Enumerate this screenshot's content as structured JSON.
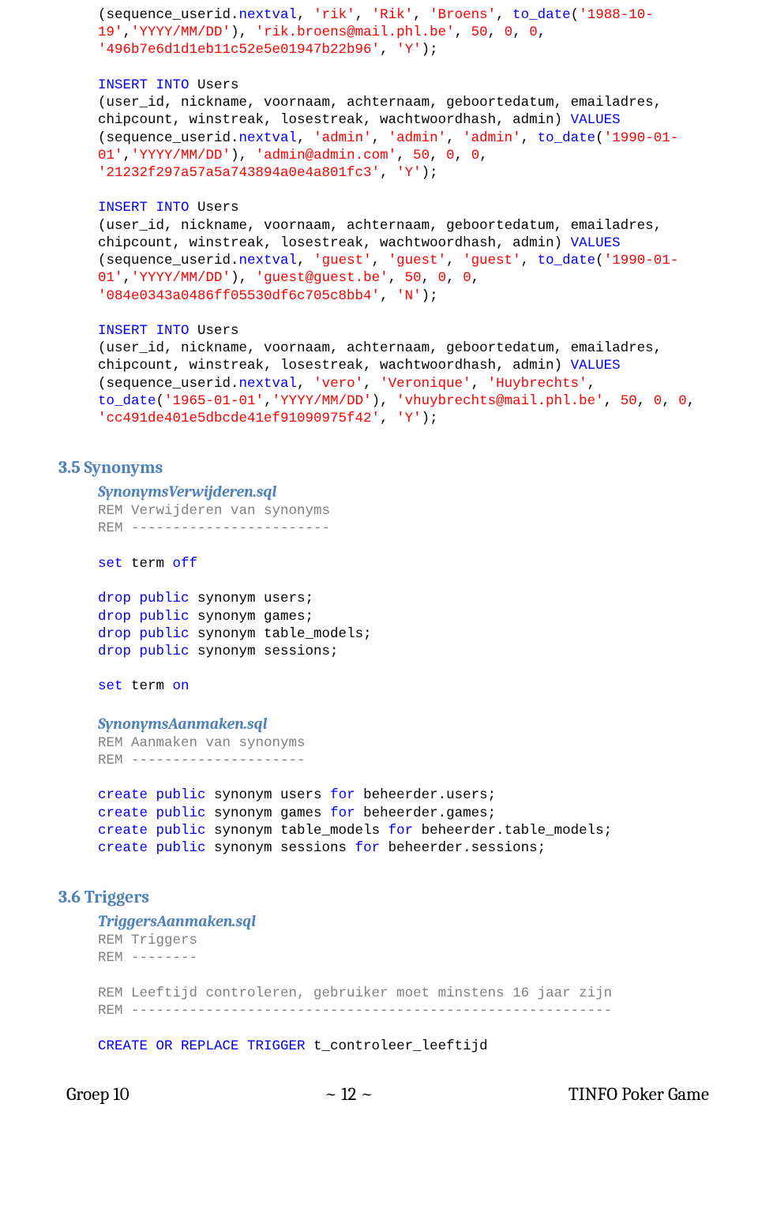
{
  "code_block_1": [
    [
      {
        "t": "(sequence_userid.",
        "c": ""
      },
      {
        "t": "nextval",
        "c": "blue"
      },
      {
        "t": ",",
        "c": ""
      },
      {
        "t": " 'rik'",
        "c": "red"
      },
      {
        "t": ",",
        "c": ""
      },
      {
        "t": " 'Rik'",
        "c": "red"
      },
      {
        "t": ",",
        "c": ""
      },
      {
        "t": " 'Broens'",
        "c": "red"
      },
      {
        "t": ",",
        "c": ""
      },
      {
        "t": " to_date",
        "c": "blue"
      },
      {
        "t": "(",
        "c": ""
      },
      {
        "t": "'1988-10-19'",
        "c": "red"
      },
      {
        "t": ",",
        "c": ""
      },
      {
        "t": "'YYYY/MM/DD'",
        "c": "red"
      },
      {
        "t": "),",
        "c": ""
      },
      {
        "t": " 'rik.broens@mail.phl.be'",
        "c": "red"
      },
      {
        "t": ",",
        "c": ""
      },
      {
        "t": " 50",
        "c": "red"
      },
      {
        "t": ",",
        "c": ""
      },
      {
        "t": " 0",
        "c": "red"
      },
      {
        "t": ",",
        "c": ""
      },
      {
        "t": " 0",
        "c": "red"
      },
      {
        "t": ",",
        "c": ""
      },
      {
        "t": " '496b7e6d1d1eb11c52e5e01947b22b96'",
        "c": "red"
      },
      {
        "t": ",",
        "c": ""
      },
      {
        "t": " 'Y'",
        "c": "red"
      },
      {
        "t": ");",
        "c": ""
      }
    ],
    [],
    [
      {
        "t": "INSERT INTO",
        "c": "blue"
      },
      {
        "t": " Users",
        "c": ""
      }
    ],
    [
      {
        "t": "(user_id, nickname, voornaam, achternaam, geboortedatum, emailadres, chipcount, winstreak, losestreak, wachtwoordhash, admin)",
        "c": ""
      },
      {
        "t": " VALUES",
        "c": "blue"
      }
    ],
    [
      {
        "t": "(sequence_userid.",
        "c": ""
      },
      {
        "t": "nextval",
        "c": "blue"
      },
      {
        "t": ",",
        "c": ""
      },
      {
        "t": " 'admin'",
        "c": "red"
      },
      {
        "t": ",",
        "c": ""
      },
      {
        "t": " 'admin'",
        "c": "red"
      },
      {
        "t": ",",
        "c": ""
      },
      {
        "t": " 'admin'",
        "c": "red"
      },
      {
        "t": ",",
        "c": ""
      },
      {
        "t": " to_date",
        "c": "blue"
      },
      {
        "t": "(",
        "c": ""
      },
      {
        "t": "'1990-01-01'",
        "c": "red"
      },
      {
        "t": ",",
        "c": ""
      },
      {
        "t": "'YYYY/MM/DD'",
        "c": "red"
      },
      {
        "t": "),",
        "c": ""
      },
      {
        "t": " 'admin@admin.com'",
        "c": "red"
      },
      {
        "t": ",",
        "c": ""
      },
      {
        "t": " 50",
        "c": "red"
      },
      {
        "t": ",",
        "c": ""
      },
      {
        "t": " 0",
        "c": "red"
      },
      {
        "t": ",",
        "c": ""
      },
      {
        "t": " 0",
        "c": "red"
      },
      {
        "t": ",",
        "c": ""
      },
      {
        "t": " '21232f297a57a5a743894a0e4a801fc3'",
        "c": "red"
      },
      {
        "t": ",",
        "c": ""
      },
      {
        "t": " 'Y'",
        "c": "red"
      },
      {
        "t": ");",
        "c": ""
      }
    ],
    [],
    [
      {
        "t": "INSERT INTO",
        "c": "blue"
      },
      {
        "t": " Users",
        "c": ""
      }
    ],
    [
      {
        "t": "(user_id, nickname, voornaam, achternaam, geboortedatum, emailadres, chipcount, winstreak, losestreak, wachtwoordhash, admin)",
        "c": ""
      },
      {
        "t": " VALUES",
        "c": "blue"
      }
    ],
    [
      {
        "t": "(sequence_userid.",
        "c": ""
      },
      {
        "t": "nextval",
        "c": "blue"
      },
      {
        "t": ",",
        "c": ""
      },
      {
        "t": " 'guest'",
        "c": "red"
      },
      {
        "t": ",",
        "c": ""
      },
      {
        "t": " 'guest'",
        "c": "red"
      },
      {
        "t": ",",
        "c": ""
      },
      {
        "t": " 'guest'",
        "c": "red"
      },
      {
        "t": ",",
        "c": ""
      },
      {
        "t": " to_date",
        "c": "blue"
      },
      {
        "t": "(",
        "c": ""
      },
      {
        "t": "'1990-01-01'",
        "c": "red"
      },
      {
        "t": ",",
        "c": ""
      },
      {
        "t": "'YYYY/MM/DD'",
        "c": "red"
      },
      {
        "t": "),",
        "c": ""
      },
      {
        "t": " 'guest@guest.be'",
        "c": "red"
      },
      {
        "t": ",",
        "c": ""
      },
      {
        "t": " 50",
        "c": "red"
      },
      {
        "t": ",",
        "c": ""
      },
      {
        "t": " 0",
        "c": "red"
      },
      {
        "t": ",",
        "c": ""
      },
      {
        "t": " 0",
        "c": "red"
      },
      {
        "t": ",",
        "c": ""
      },
      {
        "t": " '084e0343a0486ff05530df6c705c8bb4'",
        "c": "red"
      },
      {
        "t": ",",
        "c": ""
      },
      {
        "t": " 'N'",
        "c": "red"
      },
      {
        "t": ");",
        "c": ""
      }
    ],
    [],
    [
      {
        "t": "INSERT INTO",
        "c": "blue"
      },
      {
        "t": " Users",
        "c": ""
      }
    ],
    [
      {
        "t": "(user_id, nickname, voornaam, achternaam, geboortedatum, emailadres, chipcount, winstreak, losestreak, wachtwoordhash, admin)",
        "c": ""
      },
      {
        "t": " VALUES",
        "c": "blue"
      }
    ],
    [
      {
        "t": "(sequence_userid.",
        "c": ""
      },
      {
        "t": "nextval",
        "c": "blue"
      },
      {
        "t": ",",
        "c": ""
      },
      {
        "t": " 'vero'",
        "c": "red"
      },
      {
        "t": ",",
        "c": ""
      },
      {
        "t": " 'Veronique'",
        "c": "red"
      },
      {
        "t": ",",
        "c": ""
      },
      {
        "t": " 'Huybrechts'",
        "c": "red"
      },
      {
        "t": ",",
        "c": ""
      },
      {
        "t": " to_date",
        "c": "blue"
      },
      {
        "t": "(",
        "c": ""
      },
      {
        "t": "'1965-01-01'",
        "c": "red"
      },
      {
        "t": ",",
        "c": ""
      },
      {
        "t": "'YYYY/MM/DD'",
        "c": "red"
      },
      {
        "t": "),",
        "c": ""
      },
      {
        "t": " 'vhuybrechts@mail.phl.be'",
        "c": "red"
      },
      {
        "t": ",",
        "c": ""
      },
      {
        "t": " 50",
        "c": "red"
      },
      {
        "t": ",",
        "c": ""
      },
      {
        "t": " 0",
        "c": "red"
      },
      {
        "t": ",",
        "c": ""
      },
      {
        "t": " 0",
        "c": "red"
      },
      {
        "t": ",",
        "c": ""
      },
      {
        "t": " 'cc491de401e5dbcde41ef91090975f42'",
        "c": "red"
      },
      {
        "t": ",",
        "c": ""
      },
      {
        "t": " 'Y'",
        "c": "red"
      },
      {
        "t": ");",
        "c": ""
      }
    ]
  ],
  "heading_35": "3.5 Synonyms",
  "file_synverw": "SynonymsVerwijderen.sql",
  "code_block_2": [
    [
      {
        "t": "REM Verwijderen van synonyms",
        "c": "gray"
      }
    ],
    [
      {
        "t": "REM ------------------------",
        "c": "gray"
      }
    ],
    [],
    [
      {
        "t": "set",
        "c": "blue"
      },
      {
        "t": " term ",
        "c": ""
      },
      {
        "t": "off",
        "c": "blue"
      }
    ],
    [],
    [
      {
        "t": "drop public",
        "c": "blue"
      },
      {
        "t": " synonym users;",
        "c": ""
      }
    ],
    [
      {
        "t": "drop public",
        "c": "blue"
      },
      {
        "t": " synonym games;",
        "c": ""
      }
    ],
    [
      {
        "t": "drop public",
        "c": "blue"
      },
      {
        "t": " synonym table_models;",
        "c": ""
      }
    ],
    [
      {
        "t": "drop public",
        "c": "blue"
      },
      {
        "t": " synonym sessions;",
        "c": ""
      }
    ],
    [],
    [
      {
        "t": "set",
        "c": "blue"
      },
      {
        "t": " term ",
        "c": ""
      },
      {
        "t": "on",
        "c": "blue"
      }
    ]
  ],
  "file_synaan": "SynonymsAanmaken.sql",
  "code_block_3": [
    [
      {
        "t": "REM Aanmaken van synonyms",
        "c": "gray"
      }
    ],
    [
      {
        "t": "REM ---------------------",
        "c": "gray"
      }
    ],
    [],
    [
      {
        "t": "create public",
        "c": "blue"
      },
      {
        "t": " synonym users ",
        "c": ""
      },
      {
        "t": "for",
        "c": "blue"
      },
      {
        "t": " beheerder.users;",
        "c": ""
      }
    ],
    [
      {
        "t": "create public",
        "c": "blue"
      },
      {
        "t": " synonym games ",
        "c": ""
      },
      {
        "t": "for",
        "c": "blue"
      },
      {
        "t": " beheerder.games;",
        "c": ""
      }
    ],
    [
      {
        "t": "create public",
        "c": "blue"
      },
      {
        "t": " synonym table_models ",
        "c": ""
      },
      {
        "t": "for",
        "c": "blue"
      },
      {
        "t": " beheerder.table_models;",
        "c": ""
      }
    ],
    [
      {
        "t": "create public",
        "c": "blue"
      },
      {
        "t": " synonym sessions ",
        "c": ""
      },
      {
        "t": "for",
        "c": "blue"
      },
      {
        "t": " beheerder.sessions;",
        "c": ""
      }
    ]
  ],
  "heading_36": "3.6 Triggers",
  "file_trig": "TriggersAanmaken.sql",
  "code_block_4": [
    [
      {
        "t": "REM Triggers",
        "c": "gray"
      }
    ],
    [
      {
        "t": "REM --------",
        "c": "gray"
      }
    ],
    [],
    [
      {
        "t": "REM Leeftijd controleren, gebruiker moet minstens 16 jaar zijn",
        "c": "gray"
      }
    ],
    [
      {
        "t": "REM ----------------------------------------------------------",
        "c": "gray"
      }
    ],
    [],
    [
      {
        "t": "CREATE OR REPLACE TRIGGER",
        "c": "blue"
      },
      {
        "t": " t_controleer_leeftijd",
        "c": ""
      }
    ]
  ],
  "footer": {
    "left": "Groep 10",
    "mid": "~ 12 ~",
    "right": "TINFO Poker Game"
  }
}
